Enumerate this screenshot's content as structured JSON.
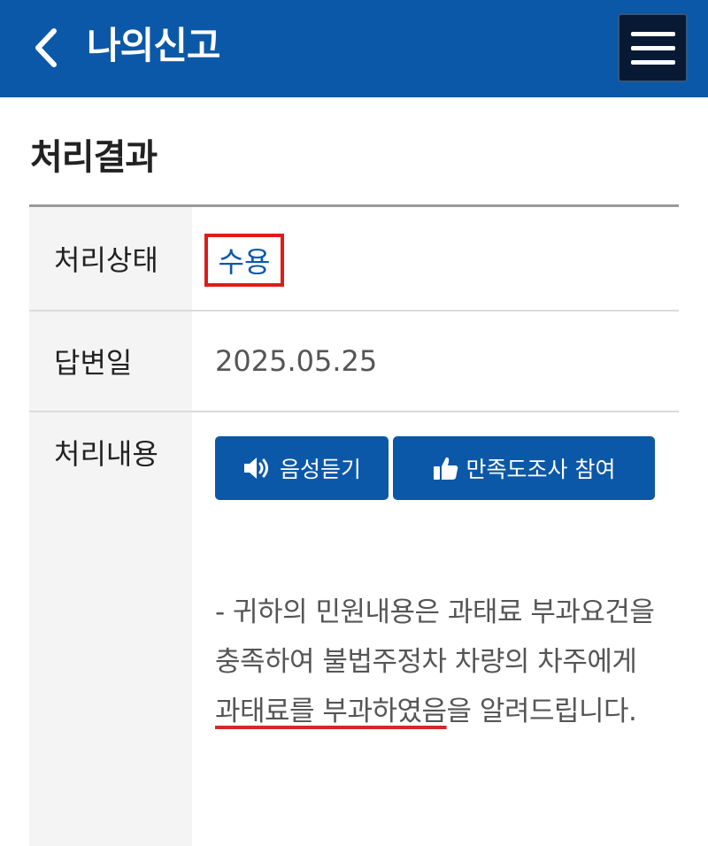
{
  "header": {
    "title": "나의신고",
    "back_icon": "chevron-left-icon",
    "menu_icon": "hamburger-menu-icon",
    "background_color": "#0b58a8"
  },
  "section": {
    "title": "처리결과"
  },
  "table": {
    "status_label": "처리상태",
    "status_value": "수용",
    "status_highlight_color": "#e01b1b",
    "answer_date_label": "답변일",
    "answer_date_value": "2025.05.25",
    "content_label": "처리내용",
    "voice_button_label": "음성듣기",
    "voice_button_icon": "speaker-icon",
    "survey_button_label": "만족도조사 참여",
    "survey_button_icon": "thumbs-up-icon",
    "content_text_before": "- 귀하의 민원내용은 과태료 부과요건을 충족하여 불법주정차 차량의 차주에게 ",
    "content_text_underlined": "과태료를 부과하였음",
    "content_text_after": "을 알려드립니다."
  }
}
